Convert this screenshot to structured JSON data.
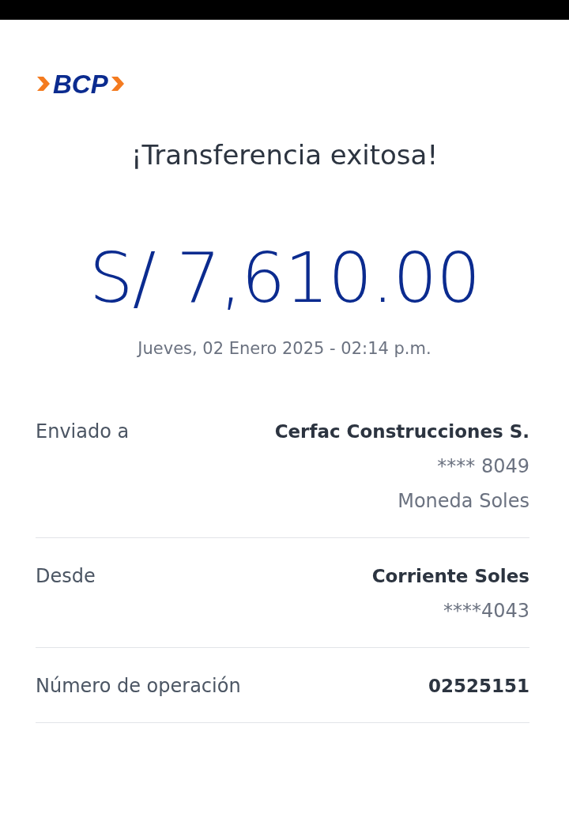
{
  "logo": {
    "text": "BCP"
  },
  "title": "¡Transferencia exitosa!",
  "amount": "S/ 7,610.00",
  "date": "Jueves, 02 Enero 2025 - 02:14 p.m.",
  "details": [
    {
      "label": "Enviado a",
      "lines": [
        "Cerfac Construcciones S.",
        "**** 8049",
        "Moneda Soles"
      ]
    },
    {
      "label": "Desde",
      "lines": [
        "Corriente Soles",
        "****4043"
      ]
    },
    {
      "label": "Número de operación",
      "lines": [
        "02525151"
      ]
    }
  ]
}
